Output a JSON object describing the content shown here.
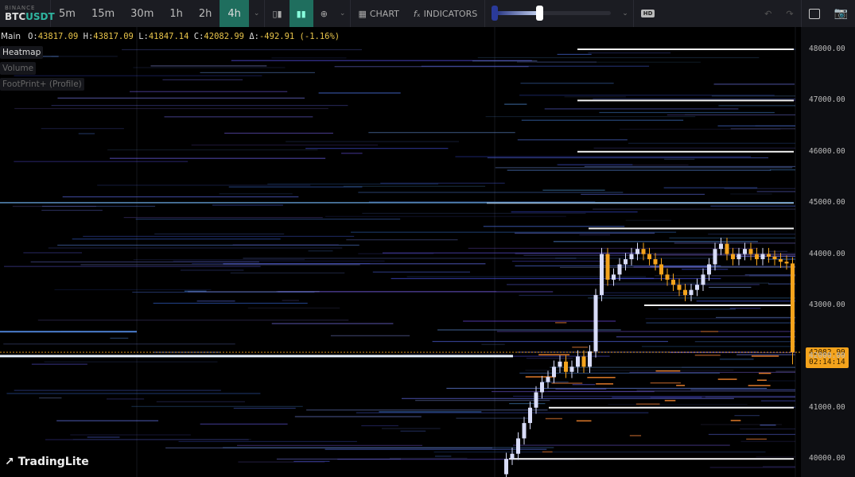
{
  "toolbar": {
    "exchange": "BINANCE",
    "base": "BTC",
    "quote": "USDT",
    "timeframes": [
      "5m",
      "15m",
      "30m",
      "1h",
      "2h",
      "4h"
    ],
    "active_timeframe": "4h",
    "chart_label": "CHART",
    "indicators_label": "INDICATORS",
    "hd_label": "HD",
    "slider_value_pct": 38,
    "icons": [
      "candles-icon",
      "bars-icon",
      "crosshair-icon",
      "chart-icon",
      "fx-icon",
      "undo-icon",
      "redo-icon",
      "layout-icon",
      "camera-icon"
    ]
  },
  "legend": {
    "main": "Main",
    "open_label": "O:",
    "open": "43817.09",
    "high_label": "H:",
    "high": "43817.09",
    "low_label": "L:",
    "low": "41847.14",
    "close_label": "C:",
    "close": "42082.99",
    "delta_label": "Δ:",
    "delta": "-492.91 (-1.16%)",
    "layers": [
      "Heatmap",
      "Volume",
      "FootPrint+ (Profile)"
    ]
  },
  "axis": {
    "ticks": [
      "48000.00",
      "47000.00",
      "46000.00",
      "45000.00",
      "44000.00",
      "43000.00",
      "42000.00",
      "41000.00",
      "40000.00"
    ],
    "ticks_values": [
      48000,
      47000,
      46000,
      45000,
      44000,
      43000,
      42000,
      41000,
      40000
    ],
    "last_price": "42082.99",
    "countdown": "02:14:14"
  },
  "colors": {
    "up": "#d8dcf8",
    "down": "#f4a31c",
    "accent": "#1f6e5e",
    "lastprice": "#f4a31c"
  },
  "brand": "TradingLite",
  "candles_close": [
    40000,
    40100,
    40400,
    40700,
    41000,
    41300,
    41500,
    41600,
    41800,
    41900,
    41700,
    41800,
    42000,
    41800,
    42100,
    43200,
    44000,
    43500,
    43600,
    43800,
    43900,
    44000,
    44100,
    44000,
    43900,
    43800,
    43600,
    43500,
    43400,
    43300,
    43200,
    43300,
    43400,
    43600,
    43800,
    44100,
    44200,
    44000,
    43900,
    44000,
    44100,
    44000,
    43900,
    44000,
    43950,
    43900,
    43850,
    43817.09,
    42082.99
  ]
}
